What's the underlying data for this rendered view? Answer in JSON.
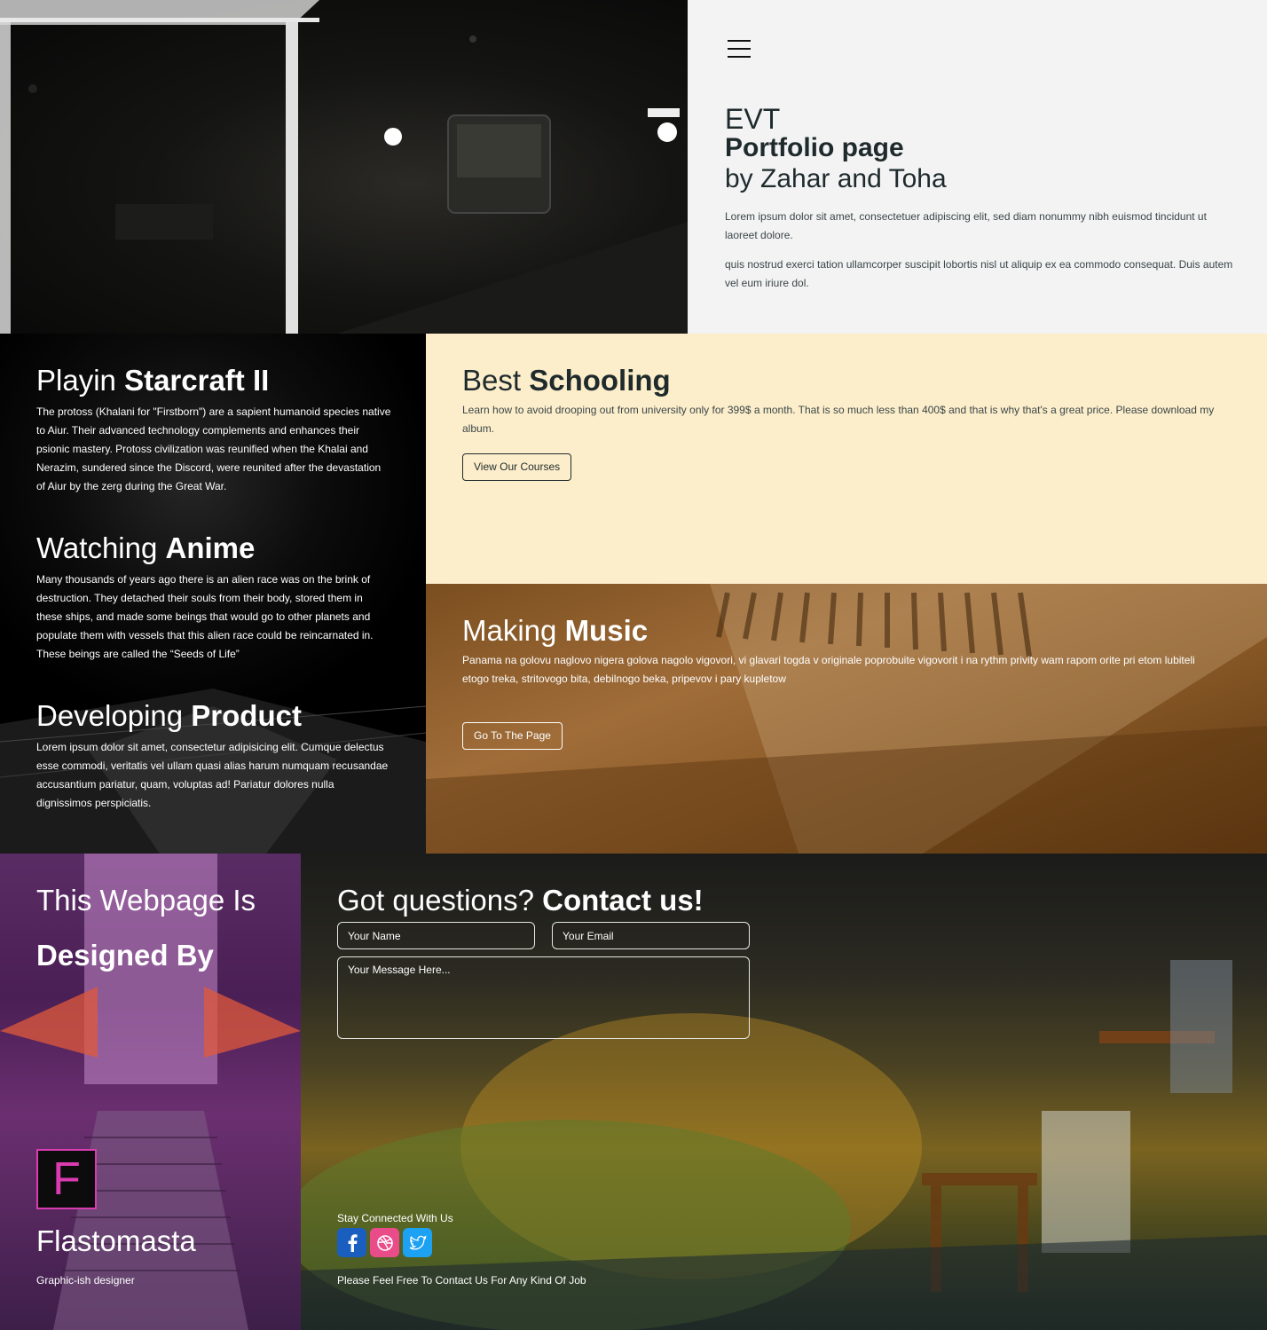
{
  "hero": {
    "eyebrow": "EVT",
    "title": "Portfolio page",
    "subtitle": "by Zahar and Toha",
    "paragraph_1": "Lorem ipsum dolor sit amet, consectetuer adipiscing elit, sed diam nonummy nibh euismod tincidunt ut laoreet dolore.",
    "paragraph_2": "quis nostrud exerci tation ullamcorper suscipit lobortis nisl ut aliquip ex ea commodo consequat. Duis autem vel eum iriure dol."
  },
  "interests": [
    {
      "light": "Playin ",
      "bold": "Starcraft II",
      "text": "The protoss (Khalani for \"Firstborn\") are a sapient humanoid species native to Aiur. Their advanced technology complements and enhances their psionic mastery. Protoss civilization was reunified when the Khalai and Nerazim, sundered since the Discord, were reunited after the devastation of Aiur by the zerg during the Great War."
    },
    {
      "light": "Watching ",
      "bold": "Anime",
      "text": "Many thousands of years ago there is an alien race was on the brink of destruction. They detached their souls from their body, stored them in these ships, and made some beings that would go to other planets and populate them with vessels that this alien race could be reincarnated in. These beings are called the “Seeds of Life”"
    },
    {
      "light": "Developing ",
      "bold": "Product",
      "text": "Lorem ipsum dolor sit amet, consectetur adipisicing elit. Cumque delectus esse commodi, veritatis vel ullam quasi alias harum numquam recusandae accusantium pariatur, quam, voluptas ad! Pariatur dolores nulla dignissimos perspiciatis."
    }
  ],
  "schooling": {
    "light": "Best ",
    "bold": "Schooling",
    "text": "Learn how to avoid drooping out from university only for 399$ a month. That is so much less than 400$ and that is why that's a great price. Please download my album.",
    "button": "View Our Courses"
  },
  "music": {
    "light": "Making ",
    "bold": "Music",
    "text": "Panama na golovu naglovo nigera golova nagolo vigovori, vi glavari togda v originale poprobuite vigovorit i na rythm privity wam rapom orite pri etom lubiteli etogo treka, stritovogo bita, debilnogo beka, pripevov i pary kupletow",
    "button": "Go To The Page"
  },
  "designer": {
    "heading_light": "This Webpage Is",
    "heading_bold": "Designed By",
    "logo_letter": "F",
    "name": "Flastomasta",
    "role": "Graphic-ish designer"
  },
  "contact": {
    "heading_light": "Got questions? ",
    "heading_bold": "Contact us!",
    "name_placeholder": "Your Name",
    "email_placeholder": "Your Email",
    "message_placeholder": "Your Message Here...",
    "stay_connected": "Stay Connected With Us",
    "footer_note": "Please Feel Free To Contact Us For Any Kind Of Job",
    "socials": [
      {
        "icon": "facebook-icon",
        "color": "#1a5fbf"
      },
      {
        "icon": "dribbble-icon",
        "color": "#ea4c89"
      },
      {
        "icon": "twitter-icon",
        "color": "#1da1f2"
      }
    ]
  }
}
